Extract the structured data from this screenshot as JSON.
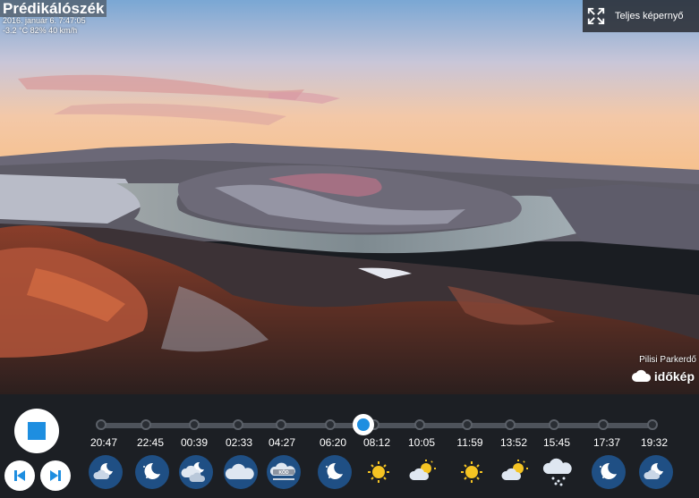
{
  "camera": {
    "title": "Prédikálószék",
    "datetime": "2016. január 6. 7:47:05",
    "conditions": "-3.2 °C 82% 40 km/h",
    "owner": "Pilisi Parkerdő",
    "brand": "időkép"
  },
  "fullscreen": {
    "label": "Teljes képernyő",
    "icon": "expand-icon"
  },
  "controls": {
    "stop_icon": "stop-icon",
    "prev_icon": "skip-back-icon",
    "next_icon": "skip-forward-icon",
    "position_fraction": 0.475
  },
  "timeline": [
    {
      "time": "20:47",
      "icon": "night-partly-cloudy"
    },
    {
      "time": "22:45",
      "icon": "night-clear"
    },
    {
      "time": "00:39",
      "icon": "night-cloudy"
    },
    {
      "time": "02:33",
      "icon": "overcast"
    },
    {
      "time": "04:27",
      "icon": "fog",
      "badge": "KÖD"
    },
    {
      "time": "06:20",
      "icon": "night-clear"
    },
    {
      "time": "08:12",
      "icon": "sunny"
    },
    {
      "time": "10:05",
      "icon": "partly-sunny"
    },
    {
      "time": "11:59",
      "icon": "sunny"
    },
    {
      "time": "13:52",
      "icon": "partly-sunny"
    },
    {
      "time": "15:45",
      "icon": "snow"
    },
    {
      "time": "17:37",
      "icon": "night-clear"
    },
    {
      "time": "19:32",
      "icon": "night-partly-cloudy"
    }
  ]
}
